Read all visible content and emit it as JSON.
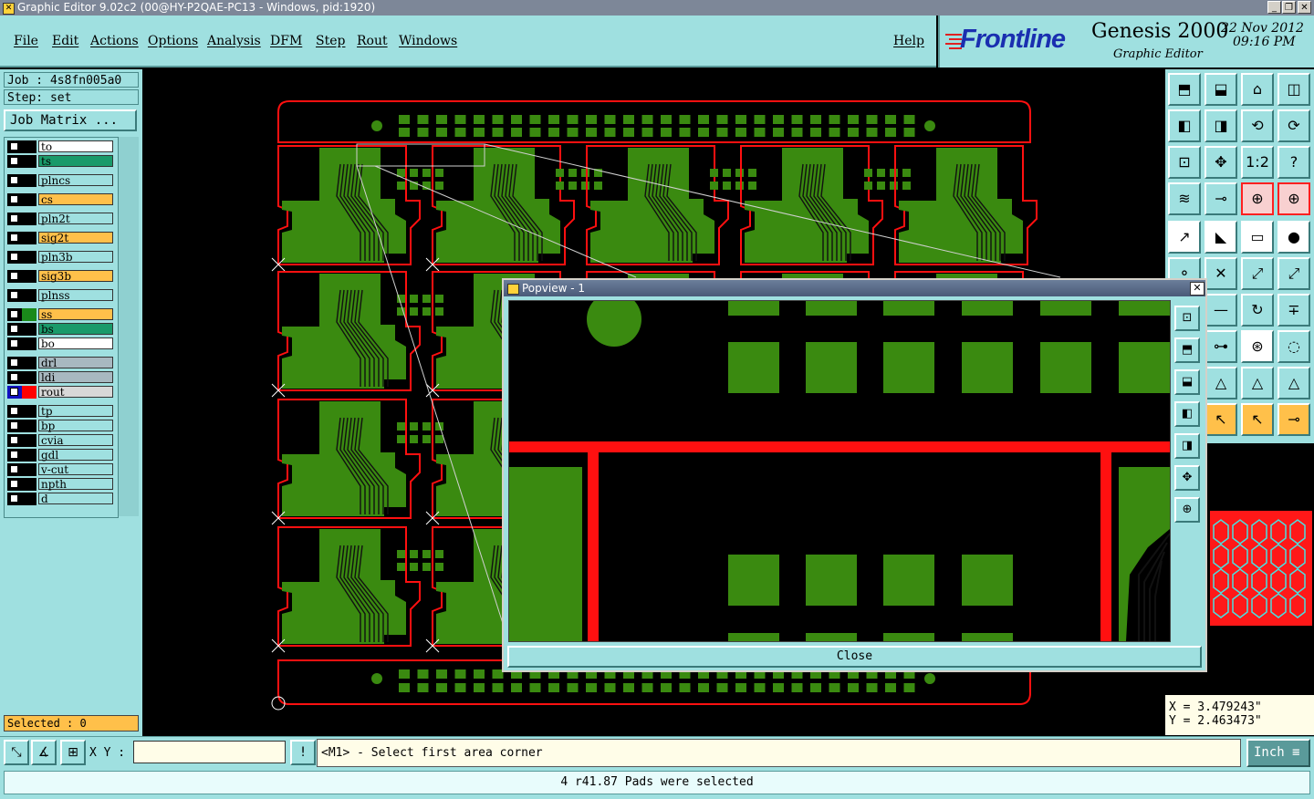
{
  "window": {
    "title": "Graphic Editor 9.02c2 (00@HY-P2QAE-PC13 - Windows, pid:1920)"
  },
  "menu": [
    "File",
    "Edit",
    "Actions",
    "Options",
    "Analysis",
    "DFM",
    "Step",
    "Rout",
    "Windows"
  ],
  "help_label": "Help",
  "brand": {
    "logo": "Frontline",
    "product": "Genesis 2000",
    "subtitle": "Graphic Editor",
    "date": "22 Nov 2012",
    "time": "09:16 PM"
  },
  "job": {
    "job_label": "Job : 4s8fn005a0",
    "step_label": "Step: set",
    "matrix_button": "Job Matrix ..."
  },
  "layers": [
    {
      "name": "to",
      "color": "#ffffff",
      "swatch": "#000000"
    },
    {
      "name": "ts",
      "color": "#1a9a6a",
      "swatch": "#000000"
    },
    {
      "name": "plncs",
      "color": "#9fe0e0",
      "swatch": "#000000"
    },
    {
      "name": "cs",
      "color": "#ffc04a",
      "swatch": "#000000"
    },
    {
      "name": "pln2t",
      "color": "#9fe0e0",
      "swatch": "#000000"
    },
    {
      "name": "sig2t",
      "color": "#ffc04a",
      "swatch": "#000000"
    },
    {
      "name": "pln3b",
      "color": "#9fe0e0",
      "swatch": "#000000"
    },
    {
      "name": "sig3b",
      "color": "#ffc04a",
      "swatch": "#000000"
    },
    {
      "name": "plnss",
      "color": "#9fe0e0",
      "swatch": "#000000"
    },
    {
      "name": "ss",
      "color": "#ffc04a",
      "swatch": "#1a8a1a"
    },
    {
      "name": "bs",
      "color": "#1a9a6a",
      "swatch": "#000000"
    },
    {
      "name": "bo",
      "color": "#ffffff",
      "swatch": "#000000"
    },
    {
      "name": "drl",
      "color": "#a8b8c0",
      "swatch": "#000000"
    },
    {
      "name": "ldi",
      "color": "#a8b8c0",
      "swatch": "#000000"
    },
    {
      "name": "rout",
      "color": "#d8d8d8",
      "swatch": "#ff0000"
    },
    {
      "name": "tp",
      "color": "#9fe0e0",
      "swatch": "#000000"
    },
    {
      "name": "bp",
      "color": "#9fe0e0",
      "swatch": "#000000"
    },
    {
      "name": "cvia",
      "color": "#9fe0e0",
      "swatch": "#000000"
    },
    {
      "name": "gdl",
      "color": "#9fe0e0",
      "swatch": "#000000"
    },
    {
      "name": "v-cut",
      "color": "#9fe0e0",
      "swatch": "#000000"
    },
    {
      "name": "npth",
      "color": "#9fe0e0",
      "swatch": "#000000"
    },
    {
      "name": "d",
      "color": "#9fe0e0",
      "swatch": "#000000"
    }
  ],
  "selected_label": "Selected : 0",
  "popview": {
    "title": "Popview - 1",
    "close_label": "Close"
  },
  "coords": {
    "x": "X = 3.479243\"",
    "y": "Y = 2.463473\""
  },
  "bottom": {
    "xy_label": "X Y :",
    "xy_value": "",
    "prompt": "<M1> - Select first area corner",
    "units": "Inch"
  },
  "status": "4 r41.87 Pads were selected",
  "colors": {
    "panel": "#9fe0e0",
    "board": "#3a8a10",
    "outline": "#ff1010",
    "highlight": "#ffc04a"
  }
}
